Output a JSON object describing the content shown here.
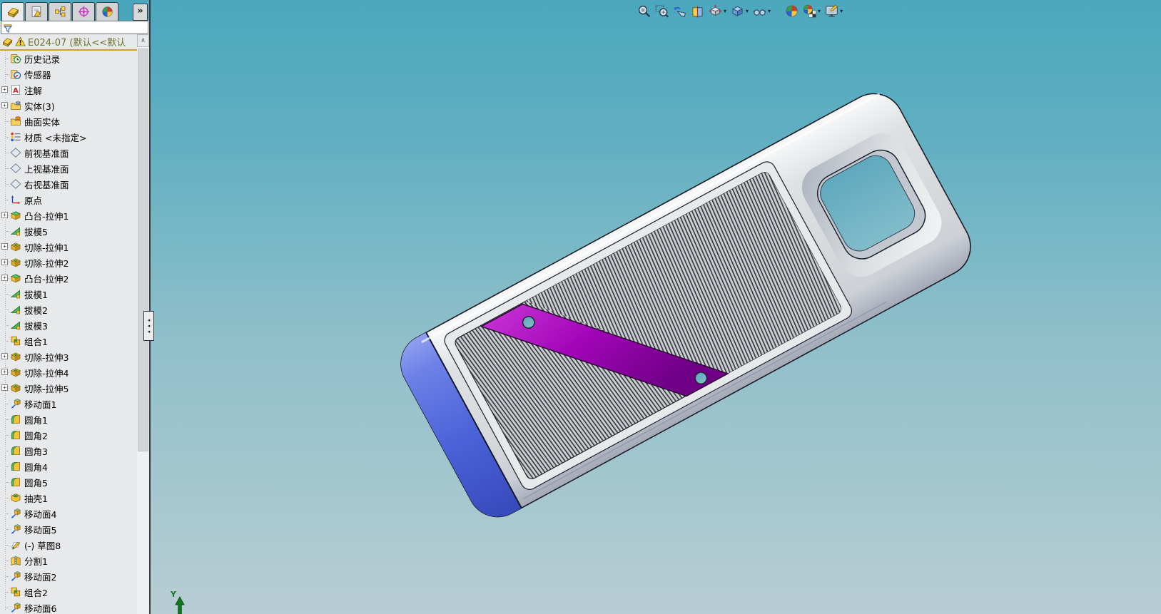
{
  "theme": {
    "viewport_top": "#4ba7bd",
    "viewport_mid": "#8fbfca",
    "viewport_bottom": "#b7cdd3",
    "panel_bg": "#e7e9eb",
    "toolbar_teal": "#4aa6bc",
    "tab_gray": "#d2d4d6",
    "accent_gold": "#c9a227",
    "tree_header_text": "#6e6e28",
    "model_body_gray": "#d8dbdd",
    "model_blue_edge": "#4c63d8",
    "model_purple_strip": "#9e00b4",
    "rib_line": "#3f4148"
  },
  "left_panel": {
    "tabs": [
      {
        "name": "featuremanager",
        "icon": "part",
        "active": true
      },
      {
        "name": "propertymanager",
        "icon": "property",
        "active": false
      },
      {
        "name": "configurationmanager",
        "icon": "config",
        "active": false
      },
      {
        "name": "dimxpertmanager",
        "icon": "dimxpert",
        "active": false
      },
      {
        "name": "displaymanager",
        "icon": "display",
        "active": false
      }
    ],
    "overflow_label": "»",
    "filter": {
      "value": "",
      "placeholder": ""
    },
    "scroll_up_glyph": "∧",
    "tree": {
      "root_label": "E024-07  (默认<<默认",
      "root_icons": [
        "part",
        "warning"
      ],
      "items": [
        {
          "label": "历史记录",
          "icon": "history",
          "expandable": false
        },
        {
          "label": "传感器",
          "icon": "sensors",
          "expandable": false
        },
        {
          "label": "注解",
          "icon": "annotations",
          "expandable": true
        },
        {
          "label": "实体(3)",
          "icon": "solid-bodies",
          "expandable": true
        },
        {
          "label": "曲面实体",
          "icon": "surface-bodies",
          "expandable": false
        },
        {
          "label": "材质 <未指定>",
          "icon": "material",
          "expandable": false
        },
        {
          "label": "前视基准面",
          "icon": "plane",
          "expandable": false
        },
        {
          "label": "上视基准面",
          "icon": "plane",
          "expandable": false
        },
        {
          "label": "右视基准面",
          "icon": "plane",
          "expandable": false
        },
        {
          "label": "原点",
          "icon": "origin",
          "expandable": false
        },
        {
          "label": "凸台-拉伸1",
          "icon": "boss-extrude",
          "expandable": true
        },
        {
          "label": "拔模5",
          "icon": "draft",
          "expandable": false
        },
        {
          "label": "切除-拉伸1",
          "icon": "cut-extrude",
          "expandable": true
        },
        {
          "label": "切除-拉伸2",
          "icon": "cut-extrude",
          "expandable": true
        },
        {
          "label": "凸台-拉伸2",
          "icon": "boss-extrude",
          "expandable": true
        },
        {
          "label": "拔模1",
          "icon": "draft",
          "expandable": false
        },
        {
          "label": "拔模2",
          "icon": "draft",
          "expandable": false
        },
        {
          "label": "拔模3",
          "icon": "draft",
          "expandable": false
        },
        {
          "label": "组合1",
          "icon": "combine",
          "expandable": false
        },
        {
          "label": "切除-拉伸3",
          "icon": "cut-extrude",
          "expandable": true
        },
        {
          "label": "切除-拉伸4",
          "icon": "cut-extrude",
          "expandable": true
        },
        {
          "label": "切除-拉伸5",
          "icon": "cut-extrude",
          "expandable": true
        },
        {
          "label": "移动面1",
          "icon": "move-face",
          "expandable": false
        },
        {
          "label": "圆角1",
          "icon": "fillet",
          "expandable": false
        },
        {
          "label": "圆角2",
          "icon": "fillet",
          "expandable": false
        },
        {
          "label": "圆角3",
          "icon": "fillet",
          "expandable": false
        },
        {
          "label": "圆角4",
          "icon": "fillet",
          "expandable": false
        },
        {
          "label": "圆角5",
          "icon": "fillet",
          "expandable": false
        },
        {
          "label": "抽壳1",
          "icon": "shell",
          "expandable": false
        },
        {
          "label": "移动面4",
          "icon": "move-face",
          "expandable": false
        },
        {
          "label": "移动面5",
          "icon": "move-face",
          "expandable": false
        },
        {
          "label": "(-) 草图8",
          "icon": "sketch",
          "expandable": false
        },
        {
          "label": "分割1",
          "icon": "split",
          "expandable": false
        },
        {
          "label": "移动面2",
          "icon": "move-face",
          "expandable": false
        },
        {
          "label": "组合2",
          "icon": "combine",
          "expandable": false
        },
        {
          "label": "移动面6",
          "icon": "move-face",
          "expandable": false
        }
      ]
    }
  },
  "viewport": {
    "hud_buttons": [
      {
        "name": "zoom-to-fit",
        "dropdown": false,
        "group_start": false
      },
      {
        "name": "zoom-to-area",
        "dropdown": false,
        "group_start": false
      },
      {
        "name": "previous-view",
        "dropdown": false,
        "group_start": false
      },
      {
        "name": "section-view",
        "dropdown": false,
        "group_start": false
      },
      {
        "name": "view-orientation",
        "dropdown": true,
        "group_start": false
      },
      {
        "name": "display-style",
        "dropdown": true,
        "group_start": false
      },
      {
        "name": "hide-show-items",
        "dropdown": true,
        "group_start": false
      },
      {
        "name": "edit-appearance",
        "dropdown": false,
        "group_start": true
      },
      {
        "name": "apply-scene",
        "dropdown": true,
        "group_start": false
      },
      {
        "name": "view-settings",
        "dropdown": true,
        "group_start": false
      }
    ],
    "dropdown_glyph": "▾",
    "triad": {
      "axis_label": "Y"
    }
  }
}
